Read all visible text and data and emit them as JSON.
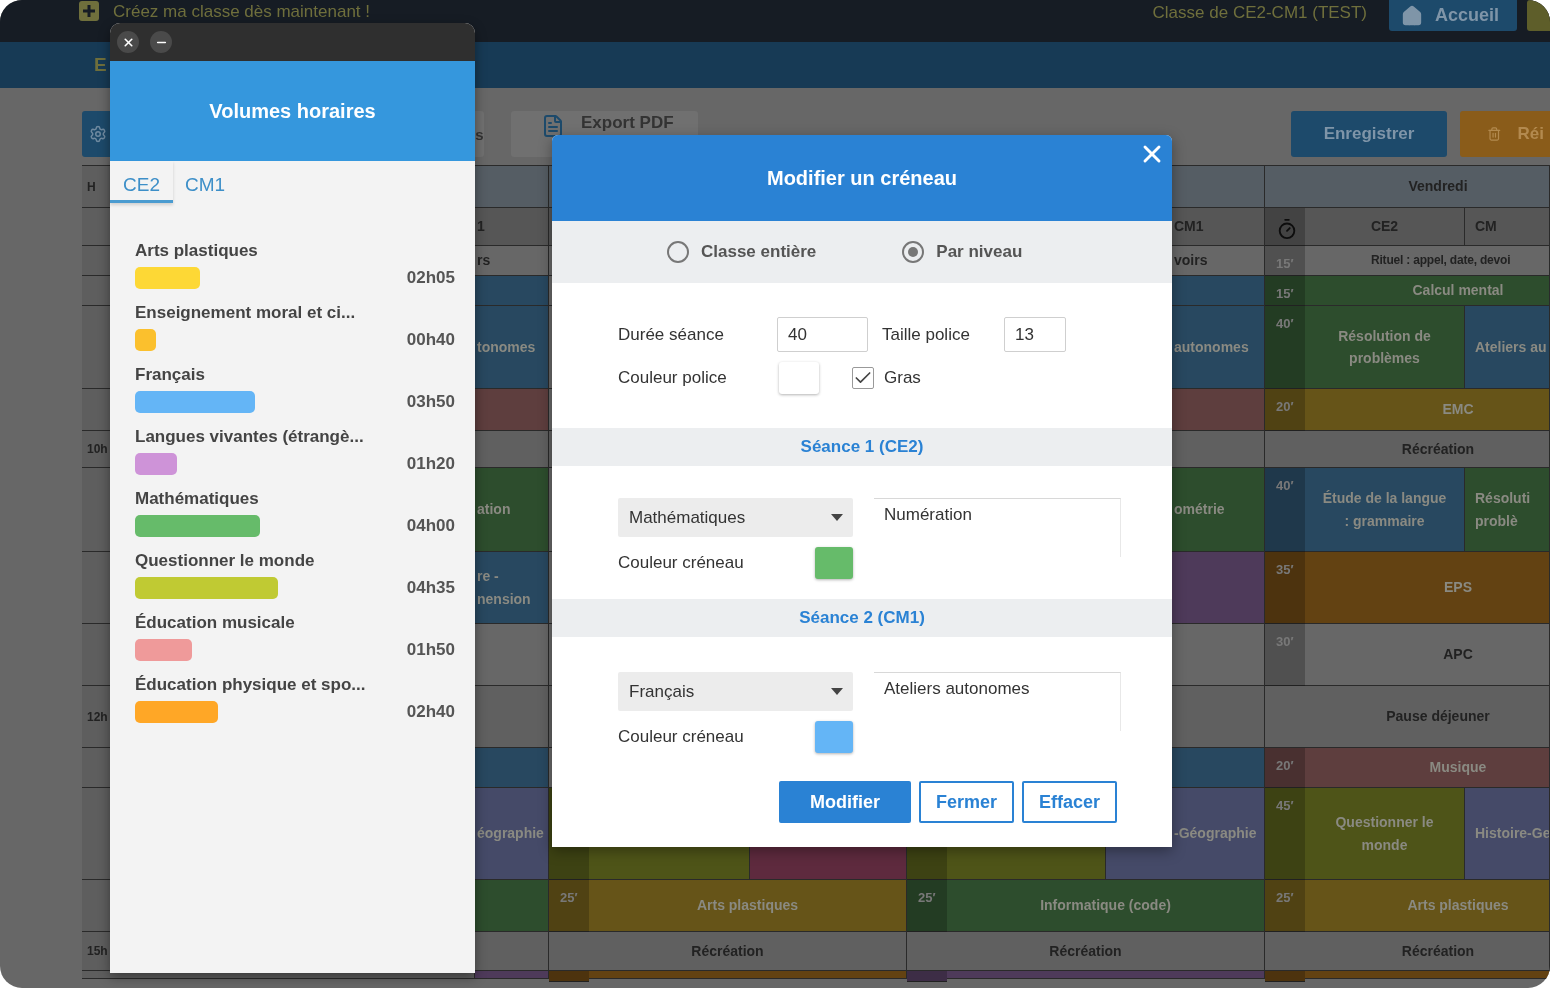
{
  "top_bar": {
    "promo": "Créez ma classe dès maintenant !",
    "class_name": "Classe de CE2-CM1 (TEST)",
    "home_button": "Accueil"
  },
  "sub_header": {
    "title": "E"
  },
  "toolbar": {
    "left_buttons": [
      {
        "kind": "settings"
      },
      {
        "kind": "text",
        "label": "s"
      },
      {
        "kind": "pdf",
        "label": "Export PDF"
      }
    ],
    "right_buttons": [
      {
        "kind": "save",
        "label": "Enregistrer"
      },
      {
        "kind": "reset",
        "label": "Réi"
      }
    ]
  },
  "timetable": {
    "rows": [
      {
        "kind": "header",
        "hour": "H",
        "days": [
          {
            "cells": [
              {
                "kind": "full"
              }
            ]
          },
          {
            "cells": [
              {
                "kind": "full"
              }
            ]
          },
          {
            "cells": [
              {
                "kind": "full"
              }
            ]
          },
          {
            "cells": [
              {
                "kind": "full",
                "text": "Vendredi"
              }
            ]
          }
        ]
      },
      {
        "kind": "classes",
        "days": [
          {
            "cells": [
              {
                "kind": "second",
                "text": "1"
              }
            ]
          },
          {
            "cells": [
              {
                "kind": "full"
              }
            ]
          },
          {
            "cells": [
              {
                "kind": "second",
                "text": "CM1"
              }
            ]
          },
          {
            "timer": true,
            "cells": [
              {
                "kind": "first",
                "text": "CE2"
              },
              {
                "kind": "second",
                "text": "CM"
              }
            ]
          }
        ]
      },
      {
        "kind": "ritual",
        "days": [
          {
            "cells": [
              {
                "kind": "second",
                "text": "rs"
              }
            ]
          },
          {
            "cells": [
              {
                "kind": "full"
              }
            ]
          },
          {
            "cells": [
              {
                "kind": "second",
                "text": "voirs"
              }
            ]
          },
          {
            "duration": "15′",
            "cells": [
              {
                "kind": "shared",
                "text": "Rituel : appel, date, devoi"
              }
            ]
          }
        ]
      },
      {
        "kind": "lesson",
        "days": [
          {
            "cells": [
              {
                "kind": "second",
                "color": "#284860"
              }
            ]
          },
          {
            "cells": [
              {
                "kind": "full"
              }
            ]
          },
          {
            "cells": [
              {
                "kind": "second",
                "color": "#284860"
              }
            ]
          },
          {
            "duration": "15′",
            "cells": [
              {
                "kind": "shared",
                "color": "#2d4d2d",
                "text": "Calcul mental"
              }
            ]
          }
        ]
      },
      {
        "kind": "lesson",
        "days": [
          {
            "cells": [
              {
                "kind": "second",
                "color": "#284860",
                "text": "tonomes"
              }
            ]
          },
          {
            "cells": [
              {
                "kind": "full"
              }
            ]
          },
          {
            "cells": [
              {
                "kind": "second",
                "color": "#284860",
                "text": "autonomes"
              }
            ]
          },
          {
            "duration": "40′",
            "cells": [
              {
                "kind": "first",
                "color": "#2d4d2d",
                "text": "Résolution de problèmes"
              },
              {
                "kind": "second",
                "color": "#284860",
                "text": "Ateliers au"
              }
            ]
          }
        ]
      },
      {
        "kind": "lesson",
        "days": [
          {
            "cells": [
              {
                "kind": "second",
                "color": "#5e3e3e"
              }
            ]
          },
          {
            "cells": [
              {
                "kind": "full"
              }
            ]
          },
          {
            "cells": [
              {
                "kind": "second",
                "color": "#5e3e3e"
              }
            ]
          },
          {
            "duration": "20′",
            "cells": [
              {
                "kind": "shared",
                "color": "#665418",
                "text": "EMC"
              }
            ]
          }
        ]
      },
      {
        "kind": "break",
        "hour": "10h",
        "days": [
          {
            "cells": [
              {
                "kind": "full"
              }
            ]
          },
          {
            "cells": [
              {
                "kind": "full"
              }
            ]
          },
          {
            "cells": [
              {
                "kind": "full"
              }
            ]
          },
          {
            "cells": [
              {
                "kind": "full",
                "text": "Récréation"
              }
            ]
          }
        ]
      },
      {
        "kind": "lesson",
        "days": [
          {
            "cells": [
              {
                "kind": "second",
                "color": "#2d4d2d",
                "text": "ation"
              }
            ]
          },
          {
            "cells": [
              {
                "kind": "full"
              }
            ]
          },
          {
            "cells": [
              {
                "kind": "second",
                "color": "#2d4d2d",
                "text": "ométrie"
              }
            ]
          },
          {
            "duration": "40′",
            "cells": [
              {
                "kind": "first",
                "color": "#284860",
                "text": "Étude de la langue : grammaire"
              },
              {
                "kind": "second",
                "color": "#2d4d2d",
                "text": "Résoluti\nproblè"
              }
            ]
          }
        ]
      },
      {
        "kind": "lesson",
        "days": [
          {
            "cells": [
              {
                "kind": "second",
                "color": "#284860",
                "text": "re -\nnension"
              }
            ]
          },
          {
            "cells": [
              {
                "kind": "full"
              }
            ]
          },
          {
            "cells": [
              {
                "kind": "second",
                "color": "#4e3a5a"
              }
            ]
          },
          {
            "duration": "35′",
            "cells": [
              {
                "kind": "shared",
                "color": "#634212",
                "text": "EPS"
              }
            ]
          }
        ]
      },
      {
        "kind": "plain",
        "days": [
          {
            "cells": [
              {
                "kind": "second"
              }
            ]
          },
          {
            "cells": [
              {
                "kind": "full"
              }
            ]
          },
          {
            "cells": [
              {
                "kind": "second"
              }
            ]
          },
          {
            "duration": "30′",
            "cells": [
              {
                "kind": "shared",
                "text": "APC"
              }
            ]
          }
        ]
      },
      {
        "kind": "break",
        "hour": "12h",
        "days": [
          {
            "cells": [
              {
                "kind": "full"
              }
            ]
          },
          {
            "cells": [
              {
                "kind": "full"
              }
            ]
          },
          {
            "cells": [
              {
                "kind": "full"
              }
            ]
          },
          {
            "cells": [
              {
                "kind": "full",
                "text": "Pause déjeuner"
              }
            ]
          }
        ]
      },
      {
        "kind": "lesson",
        "days": [
          {
            "cells": [
              {
                "kind": "second",
                "color": "#284860"
              }
            ]
          },
          {
            "cells": [
              {
                "kind": "full"
              }
            ]
          },
          {
            "cells": [
              {
                "kind": "second",
                "color": "#284860"
              }
            ]
          },
          {
            "duration": "20′",
            "cells": [
              {
                "kind": "shared",
                "color": "#5e3e3e",
                "text": "Musique"
              }
            ]
          }
        ]
      },
      {
        "kind": "lesson",
        "days": [
          {
            "cells": [
              {
                "kind": "second",
                "color": "#454a68",
                "text": "éographie"
              }
            ]
          },
          {
            "cells": [
              {
                "kind": "first",
                "color": "#4e5418"
              },
              {
                "kind": "second",
                "color": "#5e2a3e"
              }
            ]
          },
          {
            "cells": [
              {
                "kind": "first",
                "color": "#4e5418"
              },
              {
                "kind": "second",
                "color": "#454a68",
                "text": "-Géographie"
              }
            ]
          },
          {
            "duration": "45′",
            "cells": [
              {
                "kind": "first",
                "color": "#4e5418",
                "text": "Questionner le monde"
              },
              {
                "kind": "second",
                "color": "#454a68",
                "text": "Histoire-Ge"
              }
            ]
          }
        ]
      },
      {
        "kind": "lesson",
        "days": [
          {
            "cells": [
              {
                "kind": "second",
                "color": "#2d4d2d"
              }
            ]
          },
          {
            "duration": "25′",
            "cells": [
              {
                "kind": "shared",
                "color": "#665418",
                "text": "Arts plastiques"
              }
            ]
          },
          {
            "duration": "25′",
            "cells": [
              {
                "kind": "shared",
                "color": "#2d4d2d",
                "text": "Informatique (code)"
              }
            ]
          },
          {
            "duration": "25′",
            "cells": [
              {
                "kind": "shared",
                "color": "#665418",
                "text": "Arts plastiques"
              }
            ]
          }
        ]
      },
      {
        "kind": "break",
        "hour": "15h",
        "days": [
          {
            "cells": [
              {
                "kind": "full"
              }
            ]
          },
          {
            "cells": [
              {
                "kind": "full",
                "text": "Récréation"
              }
            ]
          },
          {
            "cells": [
              {
                "kind": "full",
                "text": "Récréation"
              }
            ]
          },
          {
            "cells": [
              {
                "kind": "full",
                "text": "Récréation"
              }
            ]
          }
        ]
      },
      {
        "kind": "lesson",
        "days": [
          {
            "cells": [
              {
                "kind": "second",
                "color": "#4e3a5a"
              }
            ]
          },
          {
            "cells": [
              {
                "kind": "shared",
                "color": "#634212"
              }
            ]
          },
          {
            "cells": [
              {
                "kind": "shared",
                "color": "#4e3a5a"
              }
            ]
          },
          {
            "cells": [
              {
                "kind": "shared",
                "color": "#634212"
              }
            ]
          }
        ]
      }
    ]
  },
  "volumes": {
    "title": "Volumes horaires",
    "tabs": [
      {
        "label": "CE2",
        "selected": true
      },
      {
        "label": "CM1",
        "selected": false
      }
    ],
    "items": [
      {
        "name": "Arts plastiques",
        "time": "02h05",
        "color": "#fdd835"
      },
      {
        "name": "Enseignement moral et ci...",
        "time": "00h40",
        "color": "#fbc02d"
      },
      {
        "name": "Français",
        "time": "03h50",
        "color": "#64b5f6"
      },
      {
        "name": "Langues vivantes (étrangè...",
        "time": "01h20",
        "color": "#ce93d8"
      },
      {
        "name": "Mathématiques",
        "time": "04h00",
        "color": "#66bb6a"
      },
      {
        "name": "Questionner le monde",
        "time": "04h35",
        "color": "#c0ca33"
      },
      {
        "name": "Éducation musicale",
        "time": "01h50",
        "color": "#ef9a9a"
      },
      {
        "name": "Éducation physique et spo...",
        "time": "02h40",
        "color": "#ffa726"
      }
    ]
  },
  "modal": {
    "title": "Modifier un créneau",
    "scope_options": [
      {
        "label": "Classe entière",
        "selected": false
      },
      {
        "label": "Par niveau",
        "selected": true
      }
    ],
    "duration": {
      "label": "Durée séance",
      "value": "40"
    },
    "font_size": {
      "label": "Taille police",
      "value": "13"
    },
    "font_color": {
      "label": "Couleur police",
      "color": "#ffffff"
    },
    "bold": {
      "label": "Gras",
      "checked": true
    },
    "sessions": [
      {
        "title": "Séance 1 (CE2)",
        "subject": "Mathématiques",
        "notes": "Numération",
        "color_label": "Couleur créneau",
        "color": "#66bb6a"
      },
      {
        "title": "Séance 2 (CM1)",
        "subject": "Français",
        "notes": "Ateliers autonomes",
        "color_label": "Couleur créneau",
        "color": "#64b5f6"
      }
    ],
    "buttons": [
      {
        "label": "Modifier",
        "kind": "primary"
      },
      {
        "label": "Fermer",
        "kind": "outline"
      },
      {
        "label": "Effacer",
        "kind": "outline"
      }
    ]
  }
}
